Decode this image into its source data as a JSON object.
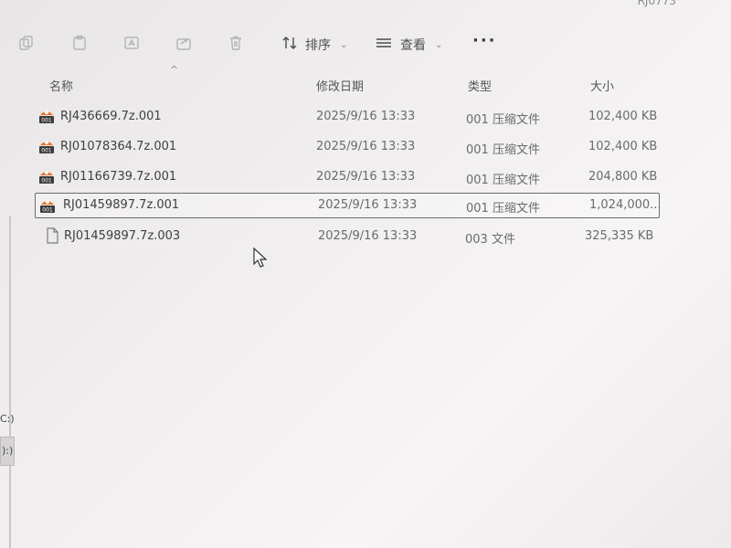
{
  "window": {
    "title_fragment": "RJ0773"
  },
  "toolbar": {
    "sort_label": "排序",
    "view_label": "查看",
    "more_label": "···"
  },
  "columns": {
    "name": "名称",
    "modified": "修改日期",
    "type": "类型",
    "size": "大小"
  },
  "files": [
    {
      "name": "RJ436669.7z.001",
      "modified": "2025/9/16 13:33",
      "type": "001 压缩文件",
      "size": "102,400 KB",
      "icon": "archive-icon"
    },
    {
      "name": "RJ01078364.7z.001",
      "modified": "2025/9/16 13:33",
      "type": "001 压缩文件",
      "size": "102,400 KB",
      "icon": "archive-icon"
    },
    {
      "name": "RJ01166739.7z.001",
      "modified": "2025/9/16 13:33",
      "type": "001 压缩文件",
      "size": "204,800 KB",
      "icon": "archive-icon"
    },
    {
      "name": "RJ01459897.7z.001",
      "modified": "2025/9/16 13:33",
      "type": "001 压缩文件",
      "size": "1,024,000...",
      "icon": "archive-icon",
      "selected": true
    },
    {
      "name": "RJ01459897.7z.003",
      "modified": "2025/9/16 13:33",
      "type": "003 文件",
      "size": "325,335 KB",
      "icon": "blank-file-icon"
    }
  ],
  "nav": {
    "fragment_1": "C:)",
    "fragment_2": "):)"
  }
}
